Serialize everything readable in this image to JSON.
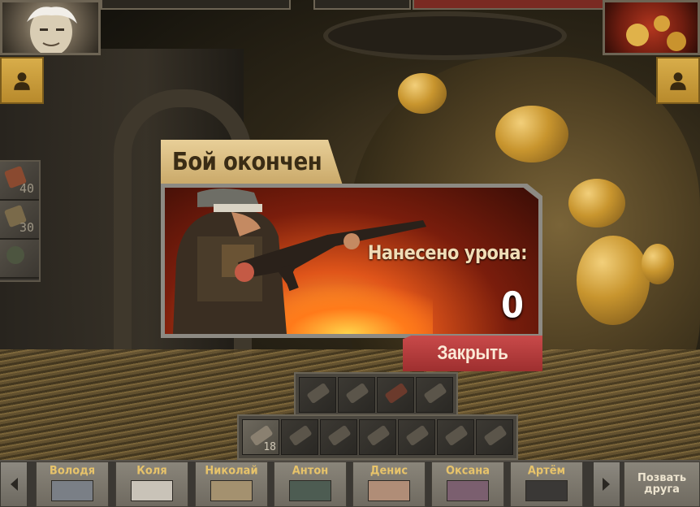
{
  "modal": {
    "title": "Бой окончен",
    "damage_label": "Нанесено урона:",
    "damage_value": "0",
    "close_label": "Закрыть"
  },
  "left_items": [
    {
      "icon": "first-aid-icon",
      "count": "40"
    },
    {
      "icon": "medkit-icon",
      "count": "30"
    },
    {
      "icon": "grenade-icon",
      "count": ""
    }
  ],
  "weapon_rows": {
    "top": [
      {
        "icon": "knife-icon",
        "count": ""
      },
      {
        "icon": "grenade-icon",
        "count": ""
      },
      {
        "icon": "dynamite-icon",
        "count": ""
      },
      {
        "icon": "explosive-icon",
        "count": ""
      }
    ],
    "bottom": [
      {
        "icon": "hammer-icon",
        "count": "18"
      },
      {
        "icon": "pistol-icon",
        "count": ""
      },
      {
        "icon": "shotgun-icon",
        "count": ""
      },
      {
        "icon": "smg-icon",
        "count": ""
      },
      {
        "icon": "launcher-icon",
        "count": ""
      },
      {
        "icon": "rifle-icon",
        "count": ""
      },
      {
        "icon": "sniper-icon",
        "count": ""
      }
    ]
  },
  "friends": [
    {
      "name": "Володя",
      "photo_color": "#7a7f86"
    },
    {
      "name": "Коля",
      "photo_color": "#c9c3b8"
    },
    {
      "name": "Николай",
      "photo_color": "#a4916f"
    },
    {
      "name": "Антон",
      "photo_color": "#4d5c52"
    },
    {
      "name": "Денис",
      "photo_color": "#b08d77"
    },
    {
      "name": "Оксана",
      "photo_color": "#7b5f6f"
    },
    {
      "name": "Артём",
      "photo_color": "#3a3836"
    }
  ],
  "invite": {
    "label_line1": "Позвать",
    "label_line2": "друга"
  },
  "colors": {
    "accent_gold": "#e8cf98",
    "close_red": "#c94a4a",
    "friend_name": "#e7c36a"
  }
}
